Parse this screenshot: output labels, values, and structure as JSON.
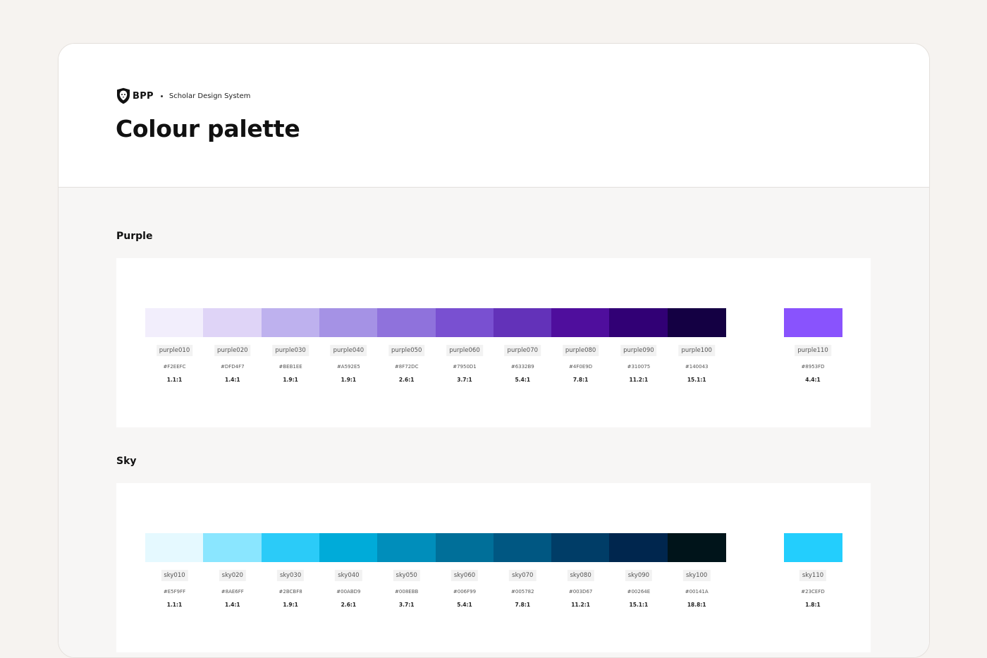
{
  "brand": {
    "logo_text": "BPP",
    "system_name": "Scholar Design System"
  },
  "page": {
    "title": "Colour palette"
  },
  "sections": [
    {
      "title": "Purple",
      "swatches": [
        {
          "name": "purple010",
          "hex": "#F2EEFC",
          "ratio": "1.1:1",
          "color": "#F2EEFC"
        },
        {
          "name": "purple020",
          "hex": "#DFD4F7",
          "ratio": "1.4:1",
          "color": "#DFD4F7"
        },
        {
          "name": "purple030",
          "hex": "#BEB1EE",
          "ratio": "1.9:1",
          "color": "#BEB1EE"
        },
        {
          "name": "purple040",
          "hex": "#A592E5",
          "ratio": "1.9:1",
          "color": "#A592E5"
        },
        {
          "name": "purple050",
          "hex": "#8F72DC",
          "ratio": "2.6:1",
          "color": "#8F72DC"
        },
        {
          "name": "purple060",
          "hex": "#7950D1",
          "ratio": "3.7:1",
          "color": "#7950D1"
        },
        {
          "name": "purple070",
          "hex": "#6332B9",
          "ratio": "5.4:1",
          "color": "#6332B9"
        },
        {
          "name": "purple080",
          "hex": "#4F0E9D",
          "ratio": "7.8:1",
          "color": "#4F0E9D"
        },
        {
          "name": "purple090",
          "hex": "#310075",
          "ratio": "11.2:1",
          "color": "#310075"
        },
        {
          "name": "purple100",
          "hex": "#140043",
          "ratio": "15.1:1",
          "color": "#140043"
        }
      ],
      "extra": {
        "name": "purple110",
        "hex": "#8953FD",
        "ratio": "4.4:1",
        "color": "#8953FD"
      }
    },
    {
      "title": "Sky",
      "swatches": [
        {
          "name": "sky010",
          "hex": "#E5F9FF",
          "ratio": "1.1:1",
          "color": "#E5F9FF"
        },
        {
          "name": "sky020",
          "hex": "#8AE6FF",
          "ratio": "1.4:1",
          "color": "#8AE6FF"
        },
        {
          "name": "sky030",
          "hex": "#2BCBF8",
          "ratio": "1.9:1",
          "color": "#2BCBF8"
        },
        {
          "name": "sky040",
          "hex": "#00ABD9",
          "ratio": "2.6:1",
          "color": "#00ABD9"
        },
        {
          "name": "sky050",
          "hex": "#008EBB",
          "ratio": "3.7:1",
          "color": "#008EBB"
        },
        {
          "name": "sky060",
          "hex": "#006F99",
          "ratio": "5.4:1",
          "color": "#006F99"
        },
        {
          "name": "sky070",
          "hex": "#005782",
          "ratio": "7.8:1",
          "color": "#005782"
        },
        {
          "name": "sky080",
          "hex": "#003D67",
          "ratio": "11.2:1",
          "color": "#003D67"
        },
        {
          "name": "sky090",
          "hex": "#00264E",
          "ratio": "15.1:1",
          "color": "#00264E"
        },
        {
          "name": "sky100",
          "hex": "#00141A",
          "ratio": "18.8:1",
          "color": "#00141A"
        }
      ],
      "extra": {
        "name": "sky110",
        "hex": "#23CEFD",
        "ratio": "1.8:1",
        "color": "#23CEFD"
      }
    }
  ]
}
